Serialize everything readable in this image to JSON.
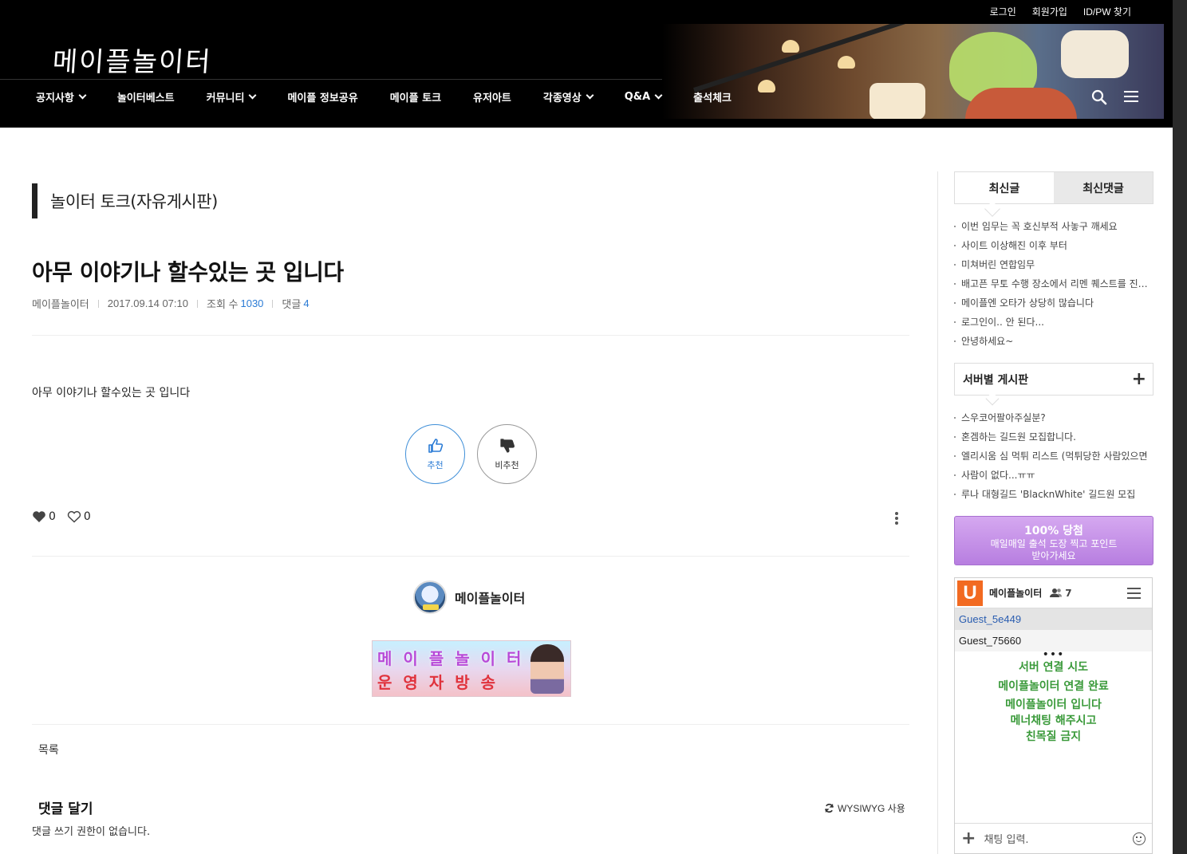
{
  "header": {
    "site_logo": "메이플놀이터",
    "top_links": [
      "로그인",
      "회원가입",
      "ID/PW 찾기"
    ],
    "nav": [
      {
        "label": "공지사항",
        "has_dropdown": true
      },
      {
        "label": "놀이터베스트",
        "has_dropdown": false
      },
      {
        "label": "커뮤니티",
        "has_dropdown": true
      },
      {
        "label": "메이플 정보공유",
        "has_dropdown": false
      },
      {
        "label": "메이플 토크",
        "has_dropdown": false
      },
      {
        "label": "유저아트",
        "has_dropdown": false
      },
      {
        "label": "각종영상",
        "has_dropdown": true
      },
      {
        "label": "Q&A",
        "has_dropdown": true
      },
      {
        "label": "출석체크",
        "has_dropdown": false
      }
    ],
    "icons": [
      "search-icon",
      "hamburger-icon"
    ]
  },
  "board": {
    "title": "놀이터 토크(자유게시판)"
  },
  "post": {
    "title": "아무 이야기나 할수있는 곳 입니다",
    "author": "메이플놀이터",
    "datetime": "2017.09.14 07:10",
    "views_label": "조회 수",
    "views": "1030",
    "comments_label": "댓글",
    "comments": "4",
    "body": "아무 이야기나 할수있는 곳 입니다",
    "vote_up_label": "추천",
    "vote_down_label": "비추천",
    "like_count": "0",
    "unlike_count": "0",
    "author_display": "메이플놀이터",
    "banner_line1": [
      "메",
      "이",
      "플",
      "놀",
      "이",
      "터"
    ],
    "banner_line2": [
      "운",
      "영",
      "자",
      "방",
      "송"
    ],
    "list_button": "목록",
    "comment_section_title": "댓글 달기",
    "wysiwyg_label": "WYSIWYG 사용",
    "no_permission": "댓글 쓰기 권한이 없습니다."
  },
  "sidebar": {
    "tabs": [
      {
        "label": "최신글",
        "active": true
      },
      {
        "label": "최신댓글",
        "active": false
      }
    ],
    "latest_posts": [
      "이번 임무는 꼭 호신부적 사놓구 깨세요",
      "사이트 이상해진 이후 부터",
      "미쳐버린 연합임무",
      "배고픈 무토 수행 장소에서 리멘 퀘스트를 진행하고 있어요",
      "메이플엔 오타가 상당히 많습니다",
      "로그인이.. 안 된다...",
      "안녕하세요~"
    ],
    "server_board_title": "서버별 게시판",
    "server_posts": [
      "스우코어팔아주실분?",
      "혼겜하는 길드원 모집합니다.",
      "엘리시움 심 먹튀 리스트 (먹튀당한 사람있으면",
      "사람이 없다...ㅠㅠ",
      "루나 대형길드 'BlacknWhite' 길드원 모집"
    ],
    "promo": {
      "headline": "100% 당첨",
      "line1": "매일매일 출석 도장 찍고 포인트",
      "line2": "받아가세요"
    },
    "chat": {
      "logo_letter": "U",
      "room_name": "메이플놀이터",
      "user_count": "7",
      "users": [
        {
          "name": "Guest_5e449",
          "me": true
        },
        {
          "name": "Guest_75660",
          "me": false
        }
      ],
      "messages": [
        "서버 연결 시도",
        "메이플놀이터 연결 완료",
        "메이플놀이터 입니다",
        "메너채팅 해주시고",
        "친목질 금지"
      ],
      "input_placeholder": "채팅 입력."
    }
  },
  "colors": {
    "header_bg": "#000000",
    "accent_blue": "#2a7bd5",
    "chat_green": "#3a9a3a",
    "promo_purple": "#c08de8",
    "chat_logo_orange": "#f26a21"
  }
}
